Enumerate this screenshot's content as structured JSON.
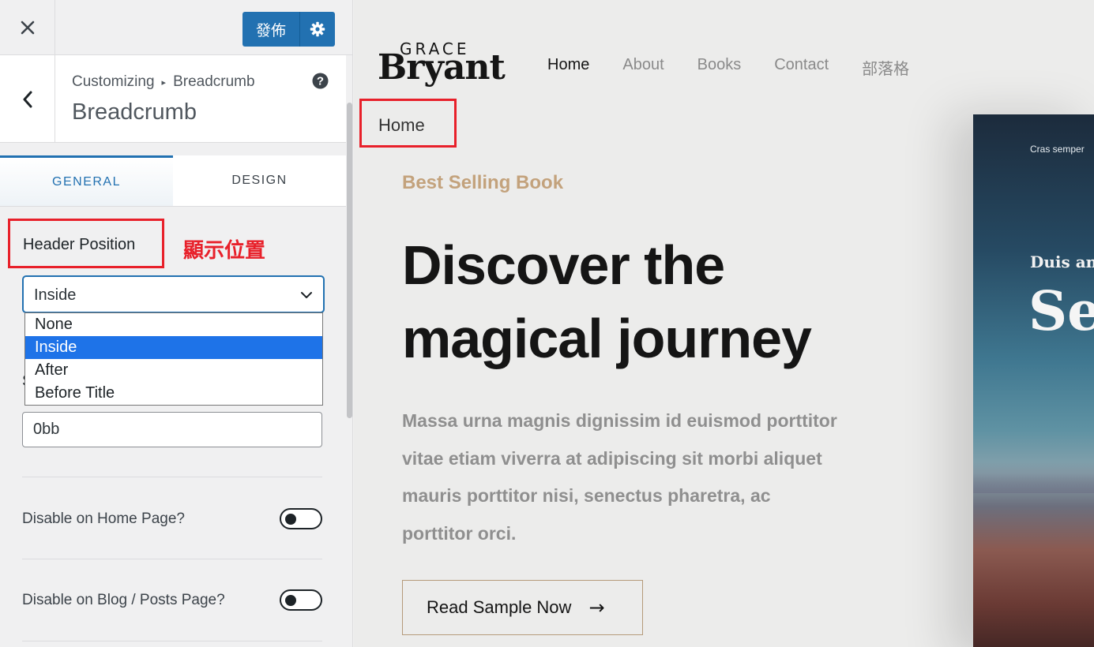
{
  "topbar": {
    "publish_label": "發佈"
  },
  "section": {
    "crumb_root": "Customizing",
    "crumb_current": "Breadcrumb",
    "title": "Breadcrumb"
  },
  "tabs": [
    {
      "label": "GENERAL",
      "active": true
    },
    {
      "label": "DESIGN",
      "active": false
    }
  ],
  "header_position": {
    "label": "Header Position",
    "annotation": "顯示位置",
    "value": "Inside",
    "options": [
      "None",
      "Inside",
      "After",
      "Before Title"
    ],
    "selected_index": 1
  },
  "separator": {
    "partial_label": "S",
    "value": "0bb"
  },
  "toggles": [
    {
      "label": "Disable on Home Page?",
      "on": false
    },
    {
      "label": "Disable on Blog / Posts Page?",
      "on": false
    }
  ],
  "preview": {
    "logo_top": "GRACE",
    "logo_main": "Bryant",
    "nav": [
      {
        "label": "Home",
        "active": true
      },
      {
        "label": "About",
        "active": false
      },
      {
        "label": "Books",
        "active": false
      },
      {
        "label": "Contact",
        "active": false
      },
      {
        "label": "部落格",
        "active": false
      }
    ],
    "breadcrumb": "Home",
    "eyebrow": "Best Selling Book",
    "title_line1": "Discover the",
    "title_line2": "magical journey",
    "text": "Massa urna magnis dignissim id euismod porttitor vitae etiam viverra at adipiscing sit morbi aliquet mauris porttitor nisi, senectus pharetra, ac porttitor orci.",
    "cta_label": "Read Sample Now",
    "cta_arrow": "→",
    "book_small": "Cras semper",
    "book_sub": "Duis ant",
    "book_big": "Se"
  },
  "colors": {
    "accent": "#2271b1",
    "annotation_red": "#e8202a",
    "eyebrow": "#c3a27c",
    "option_selected": "#1e73e8"
  }
}
